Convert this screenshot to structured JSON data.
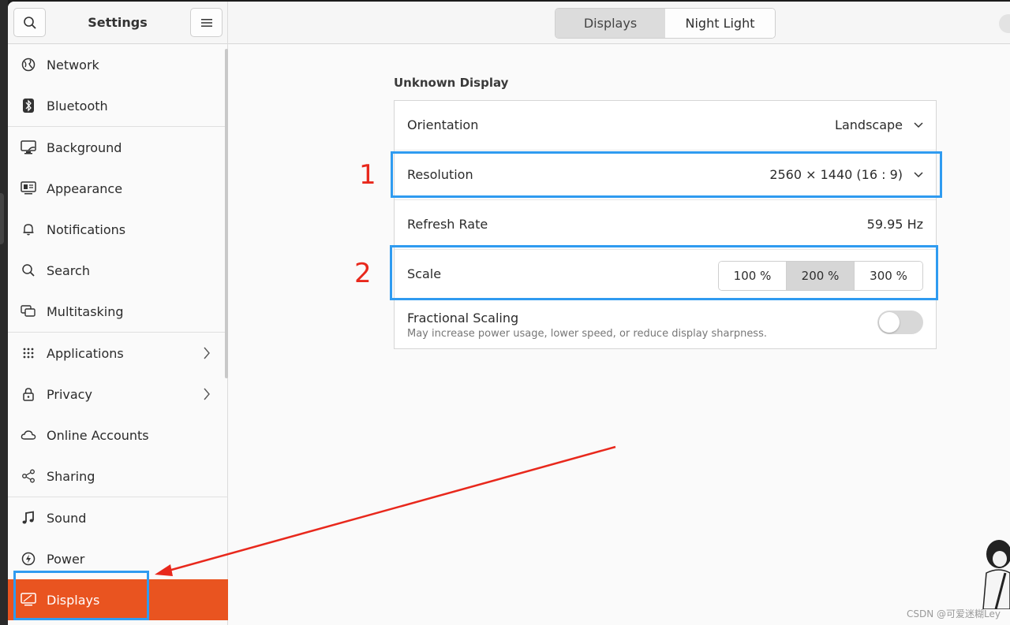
{
  "sidebar": {
    "title": "Settings",
    "search_icon": "search-icon",
    "menu_icon": "hamburger-menu-icon",
    "items": [
      {
        "label": "Network",
        "icon": "globe-icon"
      },
      {
        "label": "Bluetooth",
        "icon": "bluetooth-icon"
      },
      {
        "label": "Background",
        "icon": "background-icon"
      },
      {
        "label": "Appearance",
        "icon": "appearance-icon"
      },
      {
        "label": "Notifications",
        "icon": "bell-icon"
      },
      {
        "label": "Search",
        "icon": "search-icon"
      },
      {
        "label": "Multitasking",
        "icon": "multitasking-icon"
      },
      {
        "label": "Applications",
        "icon": "grid-icon"
      },
      {
        "label": "Privacy",
        "icon": "lock-icon"
      },
      {
        "label": "Online Accounts",
        "icon": "cloud-icon"
      },
      {
        "label": "Sharing",
        "icon": "share-icon"
      },
      {
        "label": "Sound",
        "icon": "music-note-icon"
      },
      {
        "label": "Power",
        "icon": "power-icon"
      },
      {
        "label": "Displays",
        "icon": "display-icon"
      }
    ],
    "active_item": "Displays"
  },
  "header": {
    "tabs": [
      {
        "label": "Displays",
        "active": true
      },
      {
        "label": "Night Light",
        "active": false
      }
    ]
  },
  "display": {
    "section_title": "Unknown Display",
    "orientation": {
      "label": "Orientation",
      "value": "Landscape"
    },
    "resolution": {
      "label": "Resolution",
      "value": "2560 × 1440 (16 : 9)"
    },
    "refresh_rate": {
      "label": "Refresh Rate",
      "value": "59.95 Hz"
    },
    "scale": {
      "label": "Scale",
      "options": [
        "100 %",
        "200 %",
        "300 %"
      ],
      "selected": "200 %"
    },
    "fractional_scaling": {
      "label": "Fractional Scaling",
      "description": "May increase power usage, lower speed, or reduce display sharpness.",
      "enabled": false
    }
  },
  "annotations": {
    "marker_1": "1",
    "marker_2": "2",
    "box_color": "#2f9bf0",
    "arrow_color": "#e8281c"
  },
  "colors": {
    "accent": "#e95420"
  },
  "watermark": "CSDN @可爱迷糊Ley"
}
